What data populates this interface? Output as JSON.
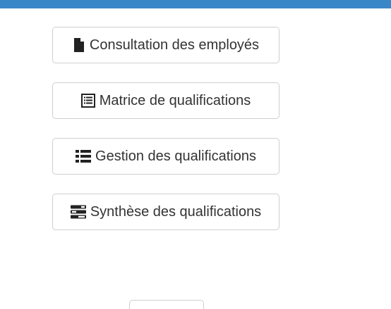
{
  "header": {
    "bar_color": "#3a87c8"
  },
  "menu": {
    "buttons": [
      {
        "label": "Consultation des employés",
        "icon": "file-icon"
      },
      {
        "label": "Matrice de qualifications",
        "icon": "list-alt-icon"
      },
      {
        "label": "Gestion des qualifications",
        "icon": "list-icon"
      },
      {
        "label": "Synthèse des qualifications",
        "icon": "tasks-icon"
      }
    ]
  }
}
